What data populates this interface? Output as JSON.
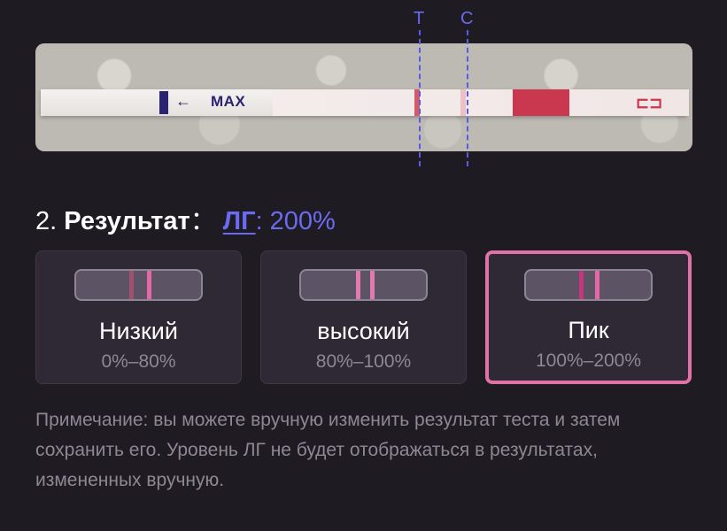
{
  "strip_photo": {
    "markers": {
      "t_label": "T",
      "c_label": "C"
    },
    "strip_text": "MAX",
    "arrow_glyph": "←"
  },
  "result": {
    "number": "2.",
    "title": "Результат",
    "colon": "：",
    "lh_label": "ЛГ",
    "lh_value": ": 200%"
  },
  "levels": [
    {
      "label": "Низкий",
      "range": "0%–80%",
      "selected": false,
      "line_colors": [
        "#a2506e",
        "#e568a6"
      ]
    },
    {
      "label": "высокий",
      "range": "80%–100%",
      "selected": false,
      "line_colors": [
        "#e27ab2",
        "#e27ab2"
      ]
    },
    {
      "label": "Пик",
      "range": "100%–200%",
      "selected": true,
      "line_colors": [
        "#c7357c",
        "#e568a6"
      ]
    }
  ],
  "note": "Примечание: вы можете вручную изменить результат теста и затем сохранить его. Уровень ЛГ не будет отображаться в результатах, измененных вручную.",
  "colors": {
    "background": "#1f1b22",
    "accent": "#6b6bf2",
    "card_bg": "#2e2934",
    "selected_border": "#e072a8",
    "muted_text": "#8e8794"
  }
}
